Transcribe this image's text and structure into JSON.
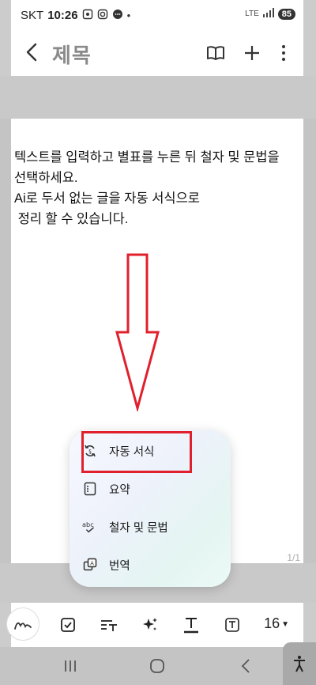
{
  "status_bar": {
    "carrier": "SKT",
    "time": "10:26",
    "network": "LTE",
    "battery": "85"
  },
  "header": {
    "title": "제목",
    "icons": [
      "back-icon",
      "book-icon",
      "plus-icon",
      "more-icon"
    ]
  },
  "note": {
    "lines": [
      "텍스트를 입력하고 별표를 누른 뒤 철자 및 문법을",
      "선택하세요.",
      "Ai로 두서 없는 글을 자동 서식으로",
      " 정리 할 수 있습니다."
    ],
    "page_indicator": "1/1"
  },
  "ai_menu": {
    "items": [
      {
        "label": "자동 서식",
        "icon": "auto-format-icon"
      },
      {
        "label": "요약",
        "icon": "summary-icon"
      },
      {
        "label": "철자 및 문법",
        "icon": "spell-check-icon"
      },
      {
        "label": "번역",
        "icon": "translate-icon"
      }
    ],
    "highlight_color": "#e0202c"
  },
  "toolbar": {
    "font_size": "16",
    "icons": [
      "pen-icon",
      "checkbox-icon",
      "text-style-icon",
      "ai-sparkle-icon",
      "text-color-icon",
      "text-box-icon"
    ]
  },
  "colors": {
    "annotation_red": "#e0202c",
    "dim_overlay": "#c4c4c4"
  }
}
